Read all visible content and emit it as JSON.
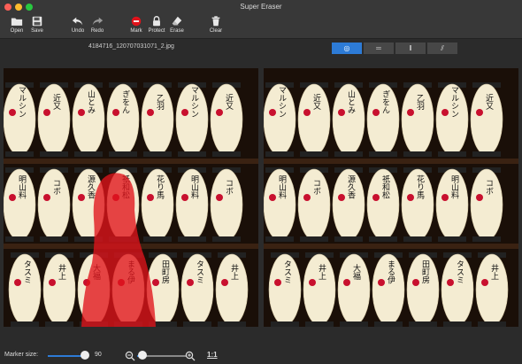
{
  "window": {
    "title": "Super Eraser"
  },
  "toolbar": {
    "open": "Open",
    "save": "Save",
    "undo": "Undo",
    "redo": "Redo",
    "mark": "Mark",
    "protect": "Protect",
    "erase": "Erase",
    "clear": "Clear"
  },
  "file": {
    "name": "4184716_120707031071_2.jpg"
  },
  "view_modes": [
    {
      "icon": "single-view-icon",
      "glyph": "◎",
      "active": true
    },
    {
      "icon": "horizontal-split-icon",
      "glyph": "═",
      "active": false
    },
    {
      "icon": "vertical-split-icon",
      "glyph": "‖",
      "active": false
    },
    {
      "icon": "diagonal-split-icon",
      "glyph": "⫽",
      "active": false
    }
  ],
  "status": {
    "marker_label": "Marker size:",
    "marker_value": "90",
    "marker_fraction": 0.85,
    "zoom_fraction": 0.05,
    "ratio_label": "1:1"
  },
  "lantern_text": {
    "row1": [
      "マルシン",
      "近又",
      "山とみ",
      "ぎをん",
      "乙羽"
    ],
    "row2": [
      "明山料",
      "コボ",
      "源久香",
      "祇和松",
      "花り馬"
    ],
    "row3": [
      "タスミ",
      "井上",
      "大福",
      "まる伊",
      "田町房"
    ]
  },
  "colors": {
    "accent": "#2d7bd6",
    "marker": "#e0131b"
  }
}
